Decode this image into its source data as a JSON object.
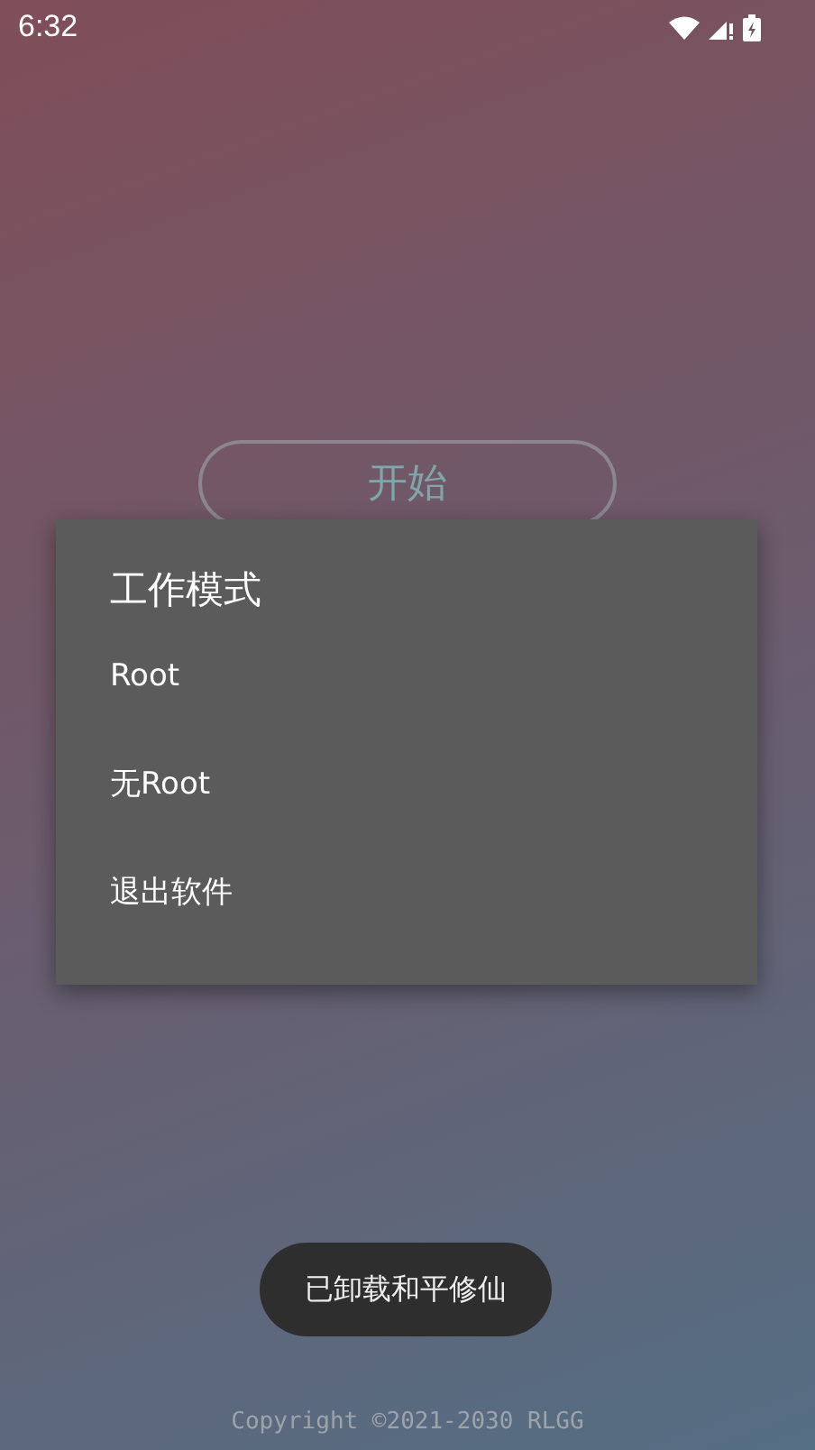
{
  "status_bar": {
    "time": "6:32"
  },
  "start_button": {
    "label": "开始"
  },
  "dialog": {
    "title": "工作模式",
    "options": [
      {
        "label": "Root"
      },
      {
        "label": "无Root"
      },
      {
        "label": "退出软件"
      }
    ]
  },
  "toast": {
    "text": "已卸载和平修仙"
  },
  "footer": {
    "copyright": "Copyright ©2021-2030 RLGG"
  }
}
